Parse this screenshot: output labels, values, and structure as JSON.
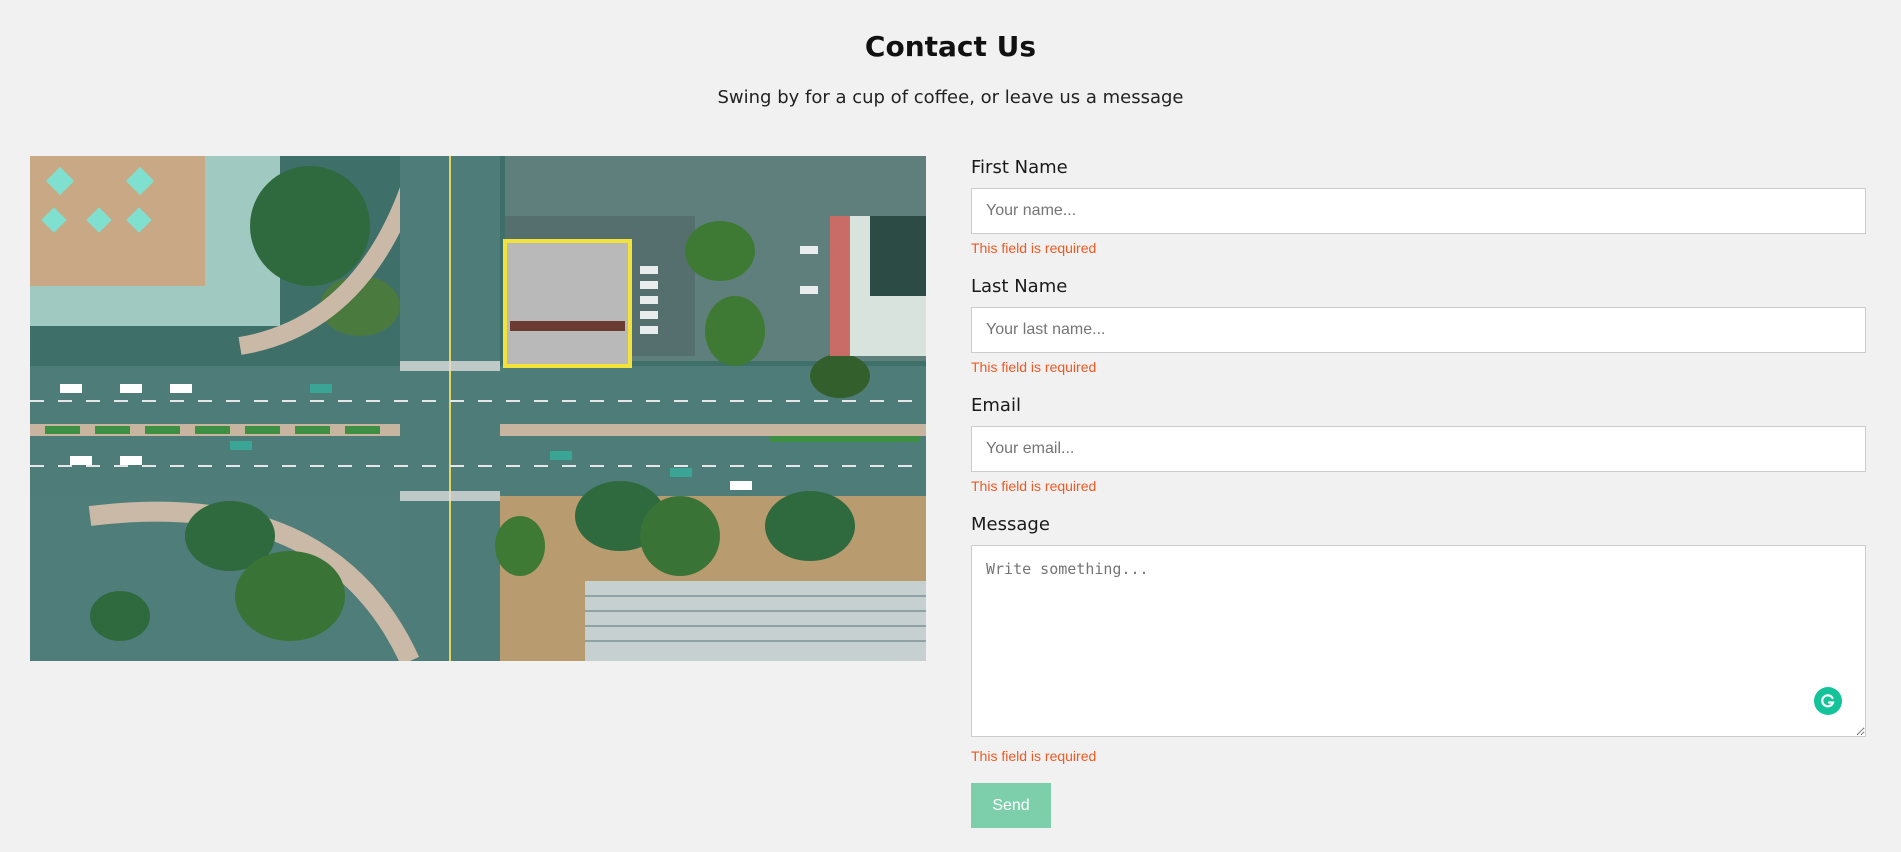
{
  "header": {
    "title": "Contact Us",
    "subtitle": "Swing by for a cup of coffee, or leave us a message"
  },
  "image": {
    "subject": "aerial view of a city intersection"
  },
  "form": {
    "first_name": {
      "label": "First Name",
      "placeholder": "Your name...",
      "error": "This field is required"
    },
    "last_name": {
      "label": "Last Name",
      "placeholder": "Your last name...",
      "error": "This field is required"
    },
    "email": {
      "label": "Email",
      "placeholder": "Your email...",
      "error": "This field is required"
    },
    "message": {
      "label": "Message",
      "placeholder": "Write something...",
      "error": "This field is required"
    },
    "send_label": "Send"
  },
  "colors": {
    "background": "#f1f1f1",
    "error": "#ef5a24",
    "send_button": "#7dcfab",
    "grammarly": "#15c39a"
  }
}
